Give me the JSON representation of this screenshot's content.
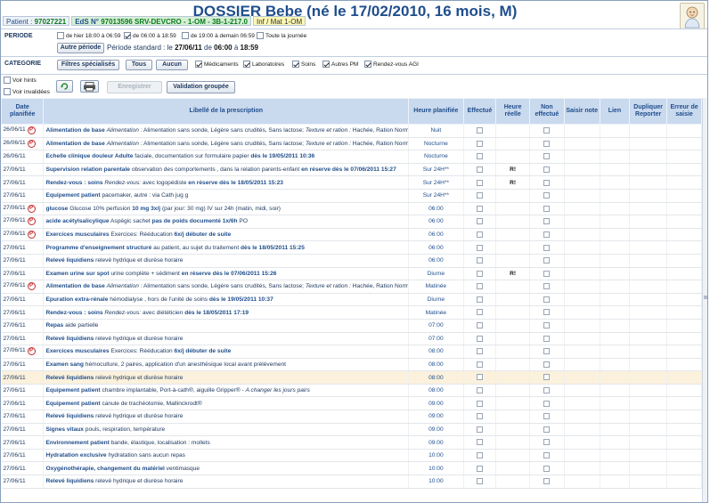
{
  "header": {
    "title": "DOSSIER Bebe (né le 17/02/2010, 16 mois, M)",
    "patient_label": "Patient :",
    "patient_id": "97027221",
    "eds_label": "EdS N°",
    "eds_value": "97013596 SRV-DEVCRO - 1-OM - 3B-1-217.0",
    "inf": "Inf / Mat 1-OM"
  },
  "periode": {
    "label": "PERIODE",
    "opt_hier": "de hier 18:00 à 06:59",
    "opt_6_18": "de 06:00 à 18:59",
    "opt_19_demain": "de 19:00 à demain 06:59",
    "opt_journee": "Toute la journée",
    "autre_btn": "Autre période",
    "std_prefix": "Période standard : le",
    "std_date": "27/06/11",
    "std_de": "de",
    "std_start": "06:00",
    "std_a": "à",
    "std_end": "18:59"
  },
  "categorie": {
    "label": "CATEGORIE",
    "filters_btn": "Filtres spécialisés",
    "tous_btn": "Tous",
    "aucun_btn": "Aucun",
    "items": [
      "Médicaments",
      "Laboratoires",
      "Soins",
      "Autres PM",
      "Rendez-vous AGI"
    ]
  },
  "options": {
    "voir_hints": "Voir hints",
    "voir_invalidees": "Voir invalidées",
    "enregistrer": "Enregistrer",
    "validation": "Validation groupée"
  },
  "columns": {
    "date": "Date planifiée",
    "libelle": "Libellé de la prescription",
    "heure_planifiee": "Heure planifiée",
    "effectue": "Effectué",
    "heure_reelle": "Heure réelle",
    "non_effectue": "Non effectué",
    "saisir_note": "Saisir note",
    "lien": "Lien",
    "dupliquer": "Dupliquer Reporter",
    "erreur": "Erreur de saisie"
  },
  "rows": [
    {
      "date": "26/06/11",
      "rx": true,
      "name": "Alimentation de base",
      "italic": "Alimentation :",
      "desc": "Alimentation sans sonde, Légère sans crudités, Sans lactose;",
      "italic2": "Texture et ration :",
      "desc2": "Hachée, Ration Normal",
      "bold": "débuter de suite",
      "time": "Nuit",
      "r": ""
    },
    {
      "date": "26/06/11",
      "rx": true,
      "name": "Alimentation de base",
      "italic": "Alimentation :",
      "desc": "Alimentation sans sonde, Légère sans crudités, Sans lactose;",
      "italic2": "Texture et ration :",
      "desc2": "Hachée, Ration Normal",
      "bold": "débuter de suite",
      "time": "Nocturne",
      "r": ""
    },
    {
      "date": "26/06/11",
      "rx": false,
      "name": "Echelle clinique douleur Adulte",
      "italic": "",
      "desc": "faciale, documentation sur formulaire papier",
      "italic2": "",
      "desc2": "",
      "bold": "dès le 19/05/2011 10:36",
      "time": "Nocturne",
      "r": ""
    },
    {
      "date": "27/06/11",
      "rx": false,
      "name": "Supervision relation parentale",
      "italic": "",
      "desc": "observation des comportements , dans la relation parents-enfant",
      "italic2": "",
      "desc2": "",
      "bold": "en réserve dès le 07/06/2011 15:27",
      "time": "Sur 24H**",
      "r": "R!"
    },
    {
      "date": "27/06/11",
      "rx": false,
      "name": "Rendez-vous : soins",
      "italic": "Rendez-vous:",
      "desc": "avec logopédiste",
      "italic2": "",
      "desc2": "",
      "bold": "en réserve dès le 18/05/2011 15:23",
      "time": "Sur 24H**",
      "r": "R!"
    },
    {
      "date": "27/06/11",
      "rx": false,
      "name": "Equipement patient",
      "italic": "",
      "desc": "pacemaker, autre : via Cath jug g",
      "italic2": "",
      "desc2": "",
      "bold": "",
      "time": "Sur 24H**",
      "r": ""
    },
    {
      "date": "27/06/11",
      "rx": true,
      "name": "glucose",
      "italic": "",
      "desc": "Glucose 10% perfusion",
      "italic2": "",
      "desc2": "",
      "bold": "10 mg 3x/j",
      "extra": "(par jour: 30 mg) IV sur 24h (matin, midi, soir)",
      "time": "06:00",
      "r": ""
    },
    {
      "date": "27/06/11",
      "rx": true,
      "name": "acide acétylsalicylique",
      "italic": "",
      "desc": "Aspégic sachet",
      "italic2": "",
      "desc2": "",
      "bold": "pas de poids documenté 1x/6h",
      "extra": "PO",
      "time": "06:00",
      "r": ""
    },
    {
      "date": "27/06/11",
      "rx": true,
      "name": "Exercices musculaires",
      "italic": "",
      "desc": "Exercices: Rééducation",
      "italic2": "",
      "desc2": "",
      "bold": "6x/j débuter de suite",
      "time": "06:00",
      "r": ""
    },
    {
      "date": "27/06/11",
      "rx": false,
      "name": "Programme d'enseignement structuré",
      "italic": "",
      "desc": "au patient, au sujet du traitement",
      "italic2": "",
      "desc2": "",
      "bold": "dès le 18/05/2011 15:25",
      "time": "06:00",
      "r": ""
    },
    {
      "date": "27/06/11",
      "rx": false,
      "name": "Relevé liquidiens",
      "italic": "",
      "desc": "relevé hydrique et diurèse horaire",
      "italic2": "",
      "desc2": "",
      "bold": "",
      "time": "06:00",
      "r": ""
    },
    {
      "date": "27/06/11",
      "rx": false,
      "name": "Examen urine sur spot",
      "italic": "",
      "desc": "urine complète + sédiment",
      "italic2": "",
      "desc2": "",
      "bold": "en réserve dès le 07/06/2011 15:26",
      "time": "Diurne",
      "r": "R!"
    },
    {
      "date": "27/06/11",
      "rx": true,
      "name": "Alimentation de base",
      "italic": "Alimentation :",
      "desc": "Alimentation sans sonde, Légère sans crudités, Sans lactose;",
      "italic2": "Texture et ration :",
      "desc2": "Hachée, Ration Normal",
      "bold": "débuter de suite",
      "time": "Matinée",
      "r": ""
    },
    {
      "date": "27/06/11",
      "rx": false,
      "name": "Epuration extra-rénale",
      "italic": "",
      "desc": "hémodialyse , hors de l'unité de soins",
      "italic2": "",
      "desc2": "",
      "bold": "dès le 19/05/2011 10:37",
      "time": "Diurne",
      "r": ""
    },
    {
      "date": "27/06/11",
      "rx": false,
      "name": "Rendez-vous : soins",
      "italic": "Rendez-vous:",
      "desc": "avec diététicien",
      "italic2": "",
      "desc2": "",
      "bold": "dès le 18/05/2011 17:19",
      "time": "Matinée",
      "r": ""
    },
    {
      "date": "27/06/11",
      "rx": false,
      "name": "Repas",
      "italic": "",
      "desc": "aide partielle",
      "italic2": "",
      "desc2": "",
      "bold": "",
      "time": "07:00",
      "r": ""
    },
    {
      "date": "27/06/11",
      "rx": false,
      "name": "Relevé liquidiens",
      "italic": "",
      "desc": "relevé hydrique et diurèse horaire",
      "italic2": "",
      "desc2": "",
      "bold": "",
      "time": "07:00",
      "r": ""
    },
    {
      "date": "27/06/11",
      "rx": true,
      "name": "Exercices musculaires",
      "italic": "",
      "desc": "Exercices: Rééducation",
      "italic2": "",
      "desc2": "",
      "bold": "6x/j débuter de suite",
      "time": "08:00",
      "r": ""
    },
    {
      "date": "27/06/11",
      "rx": false,
      "name": "Examen sang",
      "italic": "",
      "desc": "hémoculture, 2 paires, application d'un anesthésique local avant prélèvement",
      "italic2": "",
      "desc2": "",
      "bold": "",
      "time": "08:00",
      "r": ""
    },
    {
      "date": "27/06/11",
      "rx": false,
      "name": "Relevé liquidiens",
      "italic": "",
      "desc": "relevé hydrique et diurèse horaire",
      "italic2": "",
      "desc2": "",
      "bold": "",
      "time": "08:00",
      "r": "",
      "hl": true
    },
    {
      "date": "27/06/11",
      "rx": false,
      "name": "Equipement patient",
      "italic": "",
      "desc": "chambre implantable, Port-à-cath®, aiguille Gripper® -",
      "italic2": "A changer les jours pairs",
      "desc2": "",
      "bold": "",
      "time": "08:00",
      "r": ""
    },
    {
      "date": "27/06/11",
      "rx": false,
      "name": "Equipement patient",
      "italic": "",
      "desc": "canule de trachéotomie, Mallinckrodt®",
      "italic2": "",
      "desc2": "",
      "bold": "",
      "time": "09:00",
      "r": ""
    },
    {
      "date": "27/06/11",
      "rx": false,
      "name": "Relevé liquidiens",
      "italic": "",
      "desc": "relevé hydrique et diurèse horaire",
      "italic2": "",
      "desc2": "",
      "bold": "",
      "time": "09:00",
      "r": ""
    },
    {
      "date": "27/06/11",
      "rx": false,
      "name": "Signes vitaux",
      "italic": "",
      "desc": "pouls, respiration, température",
      "italic2": "",
      "desc2": "",
      "bold": "",
      "time": "09:00",
      "r": ""
    },
    {
      "date": "27/06/11",
      "rx": false,
      "name": "Environnement patient",
      "italic": "",
      "desc": "bande, élastique, localisation : mollets",
      "italic2": "",
      "desc2": "",
      "bold": "",
      "time": "09:00",
      "r": ""
    },
    {
      "date": "27/06/11",
      "rx": false,
      "name": "Hydratation exclusive",
      "italic": "",
      "desc": "hydratation sans aucun repas",
      "italic2": "",
      "desc2": "",
      "bold": "",
      "time": "10:00",
      "r": ""
    },
    {
      "date": "27/06/11",
      "rx": false,
      "name": "Oxygénothérapie, changement du matériel",
      "italic": "",
      "desc": "ventimasque",
      "italic2": "",
      "desc2": "",
      "bold": "",
      "time": "10:00",
      "r": ""
    },
    {
      "date": "27/06/11",
      "rx": false,
      "name": "Relevé liquidiens",
      "italic": "",
      "desc": "relevé hydrique et diurèse horaire",
      "italic2": "",
      "desc2": "",
      "bold": "",
      "time": "10:00",
      "r": ""
    }
  ]
}
